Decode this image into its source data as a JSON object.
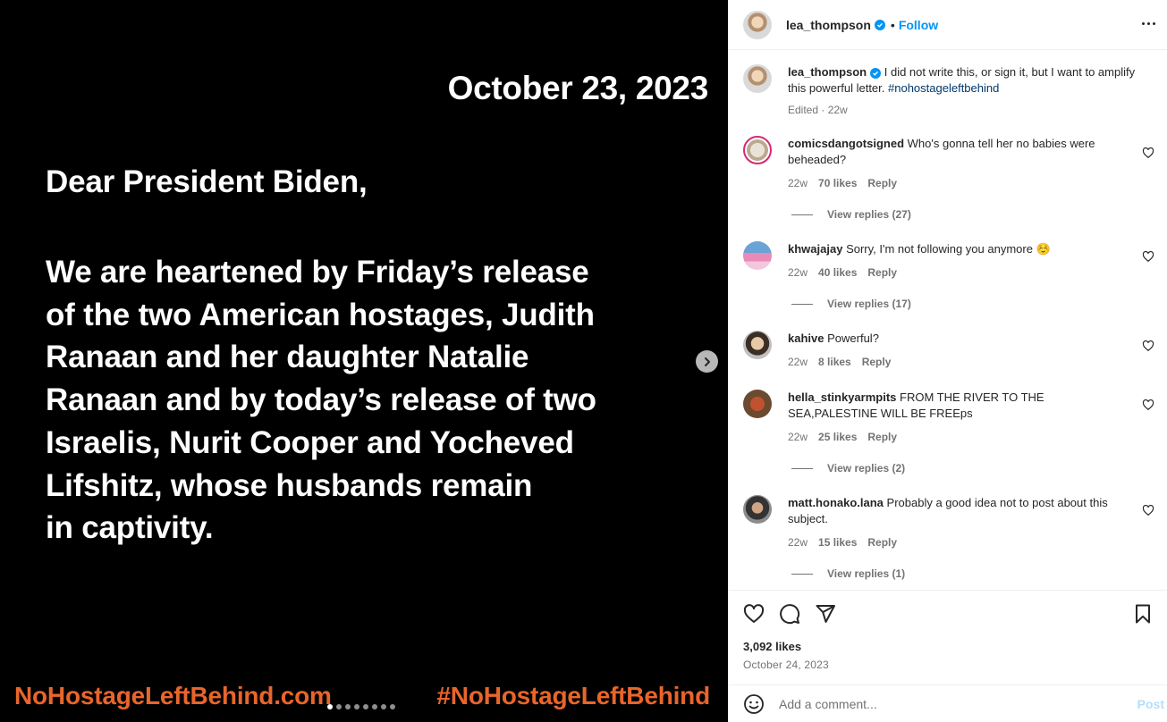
{
  "media": {
    "date_text": "October 23, 2023",
    "greeting": "Dear President Biden,",
    "letter_lines": [
      "We are heartened by Friday’s release",
      "of the two American hostages, Judith",
      "Ranaan and her daughter Natalie",
      "Ranaan and by today’s release of two",
      "Israelis, Nurit Cooper and Yocheved",
      "Lifshitz, whose husbands remain",
      "in captivity."
    ],
    "footer_left": "NoHostageLeftBehind.com",
    "footer_right": "#NoHostageLeftBehind",
    "accent_color": "#e8652b",
    "carousel_dots": 8,
    "carousel_active": 1
  },
  "header": {
    "username": "lea_thompson",
    "separator": "•",
    "follow_label": "Follow"
  },
  "caption": {
    "username": "lea_thompson",
    "text": "I did not write this, or sign it, but I want to amplify this powerful letter.",
    "hashtag": "#nohostageleftbehind",
    "meta": "Edited · 22w"
  },
  "comments": [
    {
      "username": "comicsdangotsigned",
      "text": "Who's gonna tell her no babies were beheaded?",
      "time": "22w",
      "likes": "70 likes",
      "reply": "Reply",
      "view_replies": "View replies (27)"
    },
    {
      "username": "khwajajay",
      "text": "Sorry, I'm not following you anymore ☺️",
      "time": "22w",
      "likes": "40 likes",
      "reply": "Reply",
      "view_replies": "View replies (17)"
    },
    {
      "username": "kahive",
      "text": "Powerful?",
      "time": "22w",
      "likes": "8 likes",
      "reply": "Reply",
      "view_replies": ""
    },
    {
      "username": "hella_stinkyarmpits",
      "text": "FROM THE RIVER TO THE SEA,PALESTINE WILL BE FREEps",
      "time": "22w",
      "likes": "25 likes",
      "reply": "Reply",
      "view_replies": "View replies (2)"
    },
    {
      "username": "matt.honako.lana",
      "text": "Probably a good idea not to post about this subject.",
      "time": "22w",
      "likes": "15 likes",
      "reply": "Reply",
      "view_replies": "View replies (1)"
    }
  ],
  "actions": {
    "likes": "3,092 likes",
    "date": "October 24, 2023"
  },
  "add_comment": {
    "placeholder": "Add a comment...",
    "post_label": "Post"
  },
  "colors": {
    "link_blue": "#0095f6",
    "hashtag_blue": "#00376b",
    "muted": "#737373"
  }
}
